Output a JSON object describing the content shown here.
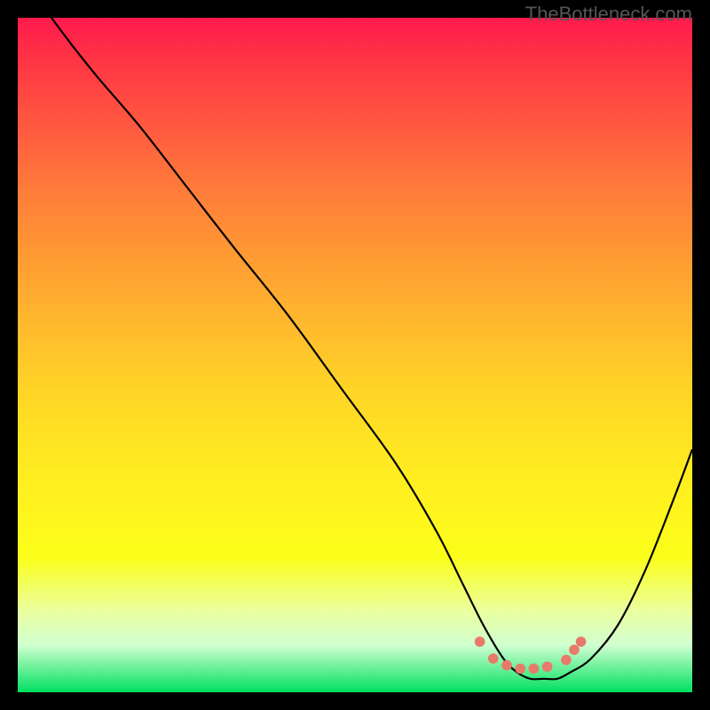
{
  "watermark": "TheBottleneck.com",
  "chart_data": {
    "type": "line",
    "title": "",
    "xlabel": "",
    "ylabel": "",
    "xlim": [
      0,
      100
    ],
    "ylim": [
      0,
      100
    ],
    "x": [
      5,
      8,
      12,
      18,
      25,
      32,
      40,
      48,
      56,
      62,
      66,
      69,
      72,
      74,
      76,
      78,
      80,
      82,
      85,
      89,
      93,
      97,
      100
    ],
    "values": [
      100,
      96,
      91,
      84,
      75,
      66,
      56,
      45,
      34,
      24,
      16,
      10,
      5,
      3,
      2,
      2,
      2,
      3,
      5,
      10,
      18,
      28,
      36
    ],
    "gradient_stops": [
      {
        "pos": 0,
        "color": "#ff1a4d"
      },
      {
        "pos": 15,
        "color": "#ff5540"
      },
      {
        "pos": 35,
        "color": "#ff9933"
      },
      {
        "pos": 55,
        "color": "#ffd426"
      },
      {
        "pos": 75,
        "color": "#fff41e"
      },
      {
        "pos": 90,
        "color": "#eaffa0"
      },
      {
        "pos": 100,
        "color": "#00e060"
      }
    ],
    "markers": [
      {
        "x": 68.5,
        "y": 7.5
      },
      {
        "x": 70.5,
        "y": 5.0
      },
      {
        "x": 72.5,
        "y": 4.0
      },
      {
        "x": 74.5,
        "y": 3.5
      },
      {
        "x": 76.5,
        "y": 3.5
      },
      {
        "x": 78.5,
        "y": 3.8
      },
      {
        "x": 81.3,
        "y": 4.8
      },
      {
        "x": 82.5,
        "y": 6.3
      },
      {
        "x": 83.5,
        "y": 7.5
      }
    ]
  }
}
